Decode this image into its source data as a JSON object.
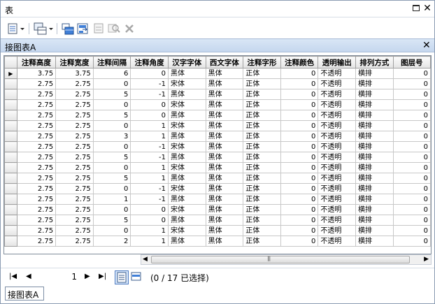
{
  "window": {
    "title": "表",
    "close_glyph": "✕"
  },
  "toolbar": {
    "icons": [
      "table-options-icon",
      "related-tables-icon",
      "select-by-attributes-icon",
      "switch-selection-icon",
      "clear-selection-icon",
      "zoom-to-selected-icon",
      "delete-selected-icon"
    ]
  },
  "tab": {
    "name": "接图表A",
    "close_glyph": "✕"
  },
  "table": {
    "columns": [
      "注释高度",
      "注释宽度",
      "注释间隔",
      "注释角度",
      "汉字字体",
      "西文字体",
      "注释字形",
      "注释颜色",
      "透明输出",
      "排列方式",
      "图层号"
    ],
    "rows": [
      [
        "3.75",
        "3.75",
        "6",
        "0",
        "黑体",
        "黑体",
        "正体",
        "0",
        "不透明",
        "横排",
        "0"
      ],
      [
        "2.75",
        "2.75",
        "0",
        "-1",
        "宋体",
        "黑体",
        "正体",
        "0",
        "不透明",
        "横排",
        "0"
      ],
      [
        "2.75",
        "2.75",
        "5",
        "-1",
        "黑体",
        "黑体",
        "正体",
        "0",
        "不透明",
        "横排",
        "0"
      ],
      [
        "2.75",
        "2.75",
        "0",
        "0",
        "宋体",
        "黑体",
        "正体",
        "0",
        "不透明",
        "横排",
        "0"
      ],
      [
        "2.75",
        "2.75",
        "5",
        "0",
        "黑体",
        "黑体",
        "正体",
        "0",
        "不透明",
        "横排",
        "0"
      ],
      [
        "2.75",
        "2.75",
        "0",
        "1",
        "宋体",
        "黑体",
        "正体",
        "0",
        "不透明",
        "横排",
        "0"
      ],
      [
        "2.75",
        "2.75",
        "3",
        "1",
        "黑体",
        "黑体",
        "正体",
        "0",
        "不透明",
        "横排",
        "0"
      ],
      [
        "2.75",
        "2.75",
        "0",
        "-1",
        "宋体",
        "黑体",
        "正体",
        "0",
        "不透明",
        "横排",
        "0"
      ],
      [
        "2.75",
        "2.75",
        "5",
        "-1",
        "黑体",
        "黑体",
        "正体",
        "0",
        "不透明",
        "横排",
        "0"
      ],
      [
        "2.75",
        "2.75",
        "0",
        "1",
        "宋体",
        "黑体",
        "正体",
        "0",
        "不透明",
        "横排",
        "0"
      ],
      [
        "2.75",
        "2.75",
        "5",
        "1",
        "黑体",
        "黑体",
        "正体",
        "0",
        "不透明",
        "横排",
        "0"
      ],
      [
        "2.75",
        "2.75",
        "0",
        "-1",
        "宋体",
        "黑体",
        "正体",
        "0",
        "不透明",
        "横排",
        "0"
      ],
      [
        "2.75",
        "2.75",
        "1",
        "-1",
        "黑体",
        "黑体",
        "正体",
        "0",
        "不透明",
        "横排",
        "0"
      ],
      [
        "2.75",
        "2.75",
        "0",
        "0",
        "宋体",
        "黑体",
        "正体",
        "0",
        "不透明",
        "横排",
        "0"
      ],
      [
        "2.75",
        "2.75",
        "5",
        "0",
        "黑体",
        "黑体",
        "正体",
        "0",
        "不透明",
        "横排",
        "0"
      ],
      [
        "2.75",
        "2.75",
        "0",
        "1",
        "宋体",
        "黑体",
        "正体",
        "0",
        "不透明",
        "横排",
        "0"
      ],
      [
        "2.75",
        "2.75",
        "2",
        "1",
        "黑体",
        "黑体",
        "正体",
        "0",
        "不透明",
        "横排",
        "0"
      ]
    ],
    "current_row_marker": "▶"
  },
  "scrollbar": {
    "left_arrow": "◀",
    "right_arrow": "▶",
    "grip": "|||"
  },
  "navigation": {
    "first": "|◀",
    "prev": "◀",
    "page": "1",
    "next": "▶",
    "last": "▶|",
    "selection_info": "(0 / 17 已选择)"
  },
  "bottom_tab": {
    "name": "接图表A"
  }
}
